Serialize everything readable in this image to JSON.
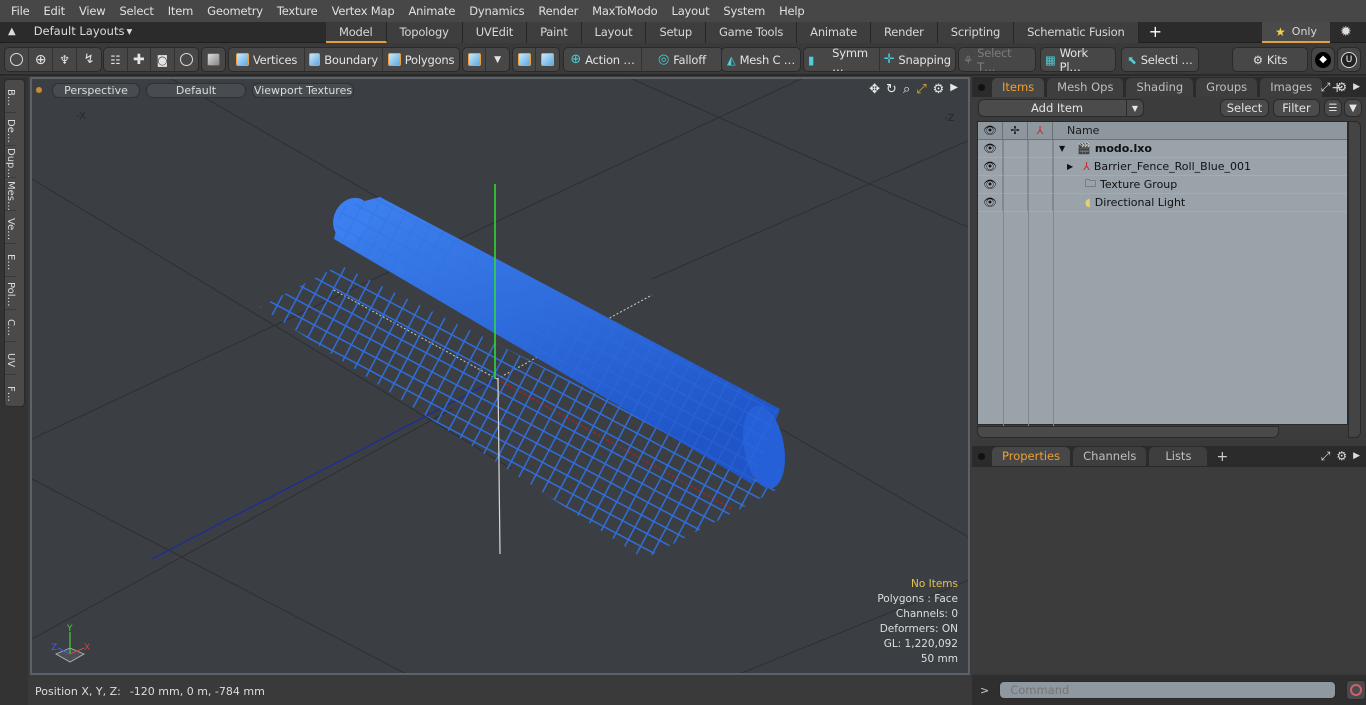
{
  "menu": [
    "File",
    "Edit",
    "View",
    "Select",
    "Item",
    "Geometry",
    "Texture",
    "Vertex Map",
    "Animate",
    "Dynamics",
    "Render",
    "MaxToModo",
    "Layout",
    "System",
    "Help"
  ],
  "layouts": {
    "label": "Default Layouts",
    "arrow": "▾",
    "icon": "▲"
  },
  "layout_tabs": [
    {
      "label": "Model",
      "active": true
    },
    {
      "label": "Topology"
    },
    {
      "label": "UVEdit"
    },
    {
      "label": "Paint"
    },
    {
      "label": "Layout"
    },
    {
      "label": "Setup"
    },
    {
      "label": "Game Tools"
    },
    {
      "label": "Animate"
    },
    {
      "label": "Render"
    },
    {
      "label": "Scripting"
    },
    {
      "label": "Schematic Fusion"
    }
  ],
  "tab_add": "+",
  "only": {
    "star": "★",
    "label": "Only"
  },
  "gear": "✹",
  "toolbar": {
    "vertices": "Vertices",
    "boundary": "Boundary",
    "polygons": "Polygons",
    "action": "Action  …",
    "falloff": "Falloff",
    "mesh": "Mesh C …",
    "symm": "Symm …",
    "snapping": "Snapping",
    "select_t": "Select T…",
    "workplane": "Work Pl…",
    "selecti": "Selecti …",
    "kits": "Kits"
  },
  "left_tabs": [
    "B…",
    "De…",
    "Dup…",
    "Mes…",
    "Ve…",
    "E…",
    "Pol…",
    "C…",
    "UV",
    "F…"
  ],
  "viewport": {
    "view": "Perspective",
    "shading": "Default",
    "textures": "Viewport Textures",
    "axis_neg_x": "-X",
    "axis_neg_z": "-Z",
    "info": {
      "selection": "No Items",
      "polygons": "Polygons : Face",
      "channels": "Channels: 0",
      "deformers": "Deformers: ON",
      "gl": "GL: 1,220,092",
      "grid": "50 mm"
    },
    "gizmo": {
      "x": "X",
      "y": "Y",
      "z": "Z"
    }
  },
  "status": {
    "label": "Position X, Y, Z:",
    "value": "-120 mm, 0 m, -784 mm"
  },
  "items_panel": {
    "tabs": [
      {
        "label": "Items",
        "active": true
      },
      {
        "label": "Mesh Ops"
      },
      {
        "label": "Shading"
      },
      {
        "label": "Groups"
      },
      {
        "label": "Images"
      }
    ],
    "add_item": "Add Item",
    "select": "Select",
    "filter": "Filter",
    "name_header": "Name",
    "rows": [
      {
        "name": "modo.lxo",
        "type": "scene"
      },
      {
        "name": "Barrier_Fence_Roll_Blue_001",
        "type": "mesh"
      },
      {
        "name": "Texture Group",
        "type": "texture"
      },
      {
        "name": "Directional Light",
        "type": "light"
      }
    ]
  },
  "props_panel": {
    "tabs": [
      {
        "label": "Properties",
        "active": true
      },
      {
        "label": "Channels"
      },
      {
        "label": "Lists"
      }
    ]
  },
  "command": {
    "prompt": ">",
    "placeholder": "Command"
  },
  "colors": {
    "accent": "#e2a040",
    "mesh_blue": "#2f6fe0",
    "viewport_bg": "#3b3f43"
  }
}
